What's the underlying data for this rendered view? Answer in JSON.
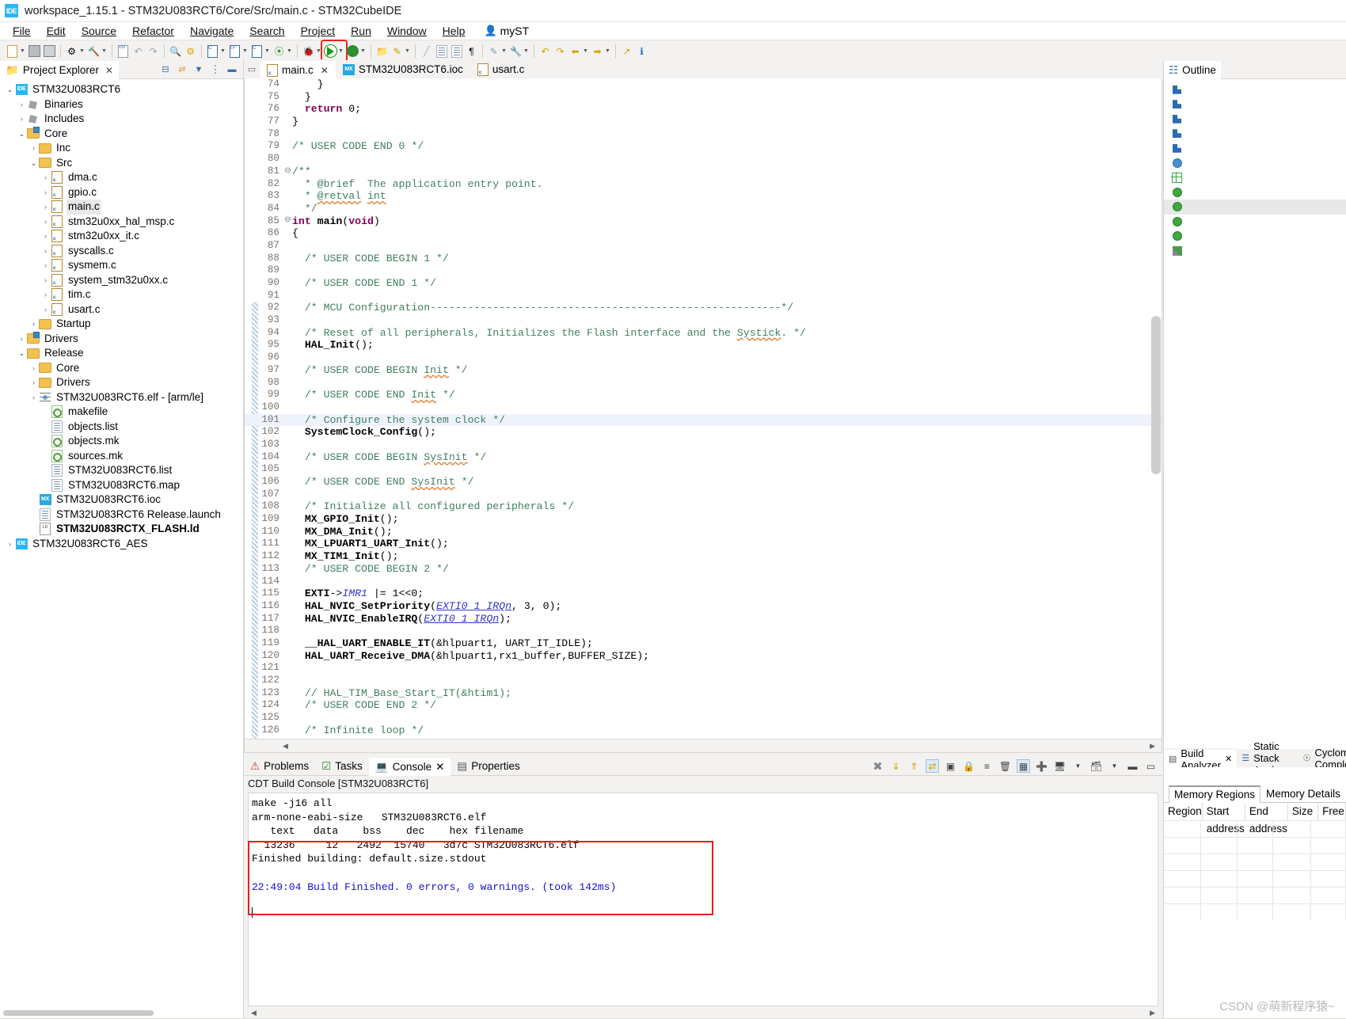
{
  "window": {
    "title": "workspace_1.15.1 - STM32U083RCT6/Core/Src/main.c - STM32CubeIDE",
    "logo": "IDE"
  },
  "menubar": {
    "items": [
      "File",
      "Edit",
      "Source",
      "Refactor",
      "Navigate",
      "Search",
      "Project",
      "Run",
      "Window",
      "Help"
    ],
    "account": "myST"
  },
  "toolbar": {
    "highlight_color": "#e8231f",
    "run_button_label": "Run",
    "groups": [
      {
        "name": "new",
        "icons": [
          "new-file-icon",
          "dropdown-arrow"
        ]
      },
      {
        "name": "save",
        "icons": [
          "save-icon",
          "save-all-icon"
        ]
      },
      {
        "name": "build",
        "icons": [
          "build-project-icon",
          "dropdown-arrow",
          "hammer-build-icon",
          "dropdown-arrow"
        ]
      },
      {
        "name": "binary",
        "icons": [
          "binary-icon"
        ]
      },
      {
        "name": "nav",
        "icons": [
          "back-undo-icon",
          "forward-redo-icon"
        ]
      },
      {
        "name": "search",
        "icons": [
          "search-icon"
        ]
      },
      {
        "name": "device",
        "icons": [
          "device-config-icon"
        ]
      },
      {
        "name": "cfg",
        "icons": [
          "c-project-icon",
          "dropdown-arrow",
          "cpp-project-icon",
          "dropdown-arrow",
          "c-file-icon",
          "dropdown-arrow"
        ]
      },
      {
        "name": "git",
        "icons": [
          "git-icon",
          "dropdown-arrow"
        ]
      },
      {
        "name": "debug",
        "icons": [
          "debug-bug-icon",
          "dropdown-arrow"
        ]
      },
      {
        "name": "run",
        "icons": [
          "run-green-icon",
          "dropdown-arrow"
        ]
      },
      {
        "name": "lock-run",
        "icons": [
          "run-lock-icon",
          "dropdown-arrow"
        ]
      },
      {
        "name": "open",
        "icons": [
          "open-resource-icon",
          "pencil-icon",
          "dropdown-arrow"
        ]
      },
      {
        "name": "format",
        "icons": [
          "ruler-icon",
          "format-doc-icon",
          "outline-icon",
          "pilcrow-icon"
        ]
      },
      {
        "name": "annotate",
        "icons": [
          "annotate-icon",
          "dropdown-arrow",
          "ext-tools-icon",
          "dropdown-arrow"
        ]
      },
      {
        "name": "history",
        "icons": [
          "prev-edit-icon",
          "next-edit-icon",
          "back-arrow-icon",
          "dropdown-arrow",
          "forward-arrow-icon",
          "dropdown-arrow"
        ]
      },
      {
        "name": "extra",
        "icons": [
          "external-link-icon",
          "info-icon"
        ]
      }
    ]
  },
  "project_explorer": {
    "title": "Project Explorer",
    "toolbar_icons": [
      "collapse-all-icon",
      "link-editor-icon",
      "filter-icon",
      "view-menu-icon",
      "minimize-icon"
    ],
    "tree": [
      {
        "label": "STM32U083RCT6",
        "indent": 0,
        "arrow": "open",
        "icon": "ide-project-icon",
        "selected": false
      },
      {
        "label": "Binaries",
        "indent": 1,
        "arrow": "closed",
        "icon": "binaries-icon"
      },
      {
        "label": "Includes",
        "indent": 1,
        "arrow": "closed",
        "icon": "includes-icon"
      },
      {
        "label": "Core",
        "indent": 1,
        "arrow": "open",
        "icon": "source-folder-icon"
      },
      {
        "label": "Inc",
        "indent": 2,
        "arrow": "closed",
        "icon": "folder-icon"
      },
      {
        "label": "Src",
        "indent": 2,
        "arrow": "open",
        "icon": "folder-icon"
      },
      {
        "label": "dma.c",
        "indent": 3,
        "arrow": "closed",
        "icon": "c-file-icon"
      },
      {
        "label": "gpio.c",
        "indent": 3,
        "arrow": "closed",
        "icon": "c-file-icon"
      },
      {
        "label": "main.c",
        "indent": 3,
        "arrow": "closed",
        "icon": "c-file-icon",
        "selected": true
      },
      {
        "label": "stm32u0xx_hal_msp.c",
        "indent": 3,
        "arrow": "closed",
        "icon": "c-file-icon"
      },
      {
        "label": "stm32u0xx_it.c",
        "indent": 3,
        "arrow": "closed",
        "icon": "c-file-icon"
      },
      {
        "label": "syscalls.c",
        "indent": 3,
        "arrow": "closed",
        "icon": "c-file-icon"
      },
      {
        "label": "sysmem.c",
        "indent": 3,
        "arrow": "closed",
        "icon": "c-file-icon"
      },
      {
        "label": "system_stm32u0xx.c",
        "indent": 3,
        "arrow": "closed",
        "icon": "c-file-icon"
      },
      {
        "label": "tim.c",
        "indent": 3,
        "arrow": "closed",
        "icon": "c-file-icon"
      },
      {
        "label": "usart.c",
        "indent": 3,
        "arrow": "closed",
        "icon": "c-file-icon"
      },
      {
        "label": "Startup",
        "indent": 2,
        "arrow": "closed",
        "icon": "folder-icon"
      },
      {
        "label": "Drivers",
        "indent": 1,
        "arrow": "closed",
        "icon": "source-folder-icon"
      },
      {
        "label": "Release",
        "indent": 1,
        "arrow": "open",
        "icon": "folder-icon"
      },
      {
        "label": "Core",
        "indent": 2,
        "arrow": "closed",
        "icon": "folder-icon"
      },
      {
        "label": "Drivers",
        "indent": 2,
        "arrow": "closed",
        "icon": "folder-icon"
      },
      {
        "label": "STM32U083RCT6.elf - [arm/le]",
        "indent": 2,
        "arrow": "closed",
        "icon": "elf-icon"
      },
      {
        "label": "makefile",
        "indent": 3,
        "arrow": "none",
        "icon": "makefile-icon"
      },
      {
        "label": "objects.list",
        "indent": 3,
        "arrow": "none",
        "icon": "plain-file-icon"
      },
      {
        "label": "objects.mk",
        "indent": 3,
        "arrow": "none",
        "icon": "makefile-icon"
      },
      {
        "label": "sources.mk",
        "indent": 3,
        "arrow": "none",
        "icon": "makefile-icon"
      },
      {
        "label": "STM32U083RCT6.list",
        "indent": 3,
        "arrow": "none",
        "icon": "plain-file-icon"
      },
      {
        "label": "STM32U083RCT6.map",
        "indent": 3,
        "arrow": "none",
        "icon": "plain-file-icon"
      },
      {
        "label": "STM32U083RCT6.ioc",
        "indent": 2,
        "arrow": "none",
        "icon": "ioc-icon"
      },
      {
        "label": "STM32U083RCT6 Release.launch",
        "indent": 2,
        "arrow": "none",
        "icon": "plain-file-icon"
      },
      {
        "label": "STM32U083RCTX_FLASH.ld",
        "indent": 2,
        "arrow": "none",
        "icon": "ld-file-icon",
        "bold": true
      },
      {
        "label": "STM32U083RCT6_AES",
        "indent": 0,
        "arrow": "closed",
        "icon": "ide-project-closed-icon"
      }
    ]
  },
  "editor": {
    "tabs": [
      {
        "label": "main.c",
        "icon": "c-file-icon",
        "active": true,
        "closable": true
      },
      {
        "label": "STM32U083RCT6.ioc",
        "icon": "ioc-icon",
        "active": false,
        "closable": false
      },
      {
        "label": "usart.c",
        "icon": "c-file-icon",
        "active": false,
        "closable": false
      }
    ],
    "first_line": 74,
    "highlighted_line": 101,
    "lines": [
      {
        "n": 74,
        "text": "    }",
        "style": "plain"
      },
      {
        "n": 75,
        "text": "  }",
        "style": "plain"
      },
      {
        "n": 76,
        "text": "  return 0;",
        "style": "return"
      },
      {
        "n": 77,
        "text": "}",
        "style": "plain"
      },
      {
        "n": 78,
        "text": "",
        "style": "plain"
      },
      {
        "n": 79,
        "text": "/* USER CODE END 0 */",
        "style": "comment"
      },
      {
        "n": 80,
        "text": "",
        "style": "plain"
      },
      {
        "n": 81,
        "text": "/**",
        "style": "comment",
        "fold": true
      },
      {
        "n": 82,
        "text": "  * @brief  The application entry point.",
        "style": "comment"
      },
      {
        "n": 83,
        "text": "  * @retval int",
        "style": "comment-wavy"
      },
      {
        "n": 84,
        "text": "  */",
        "style": "comment"
      },
      {
        "n": 85,
        "text": "int main(void)",
        "style": "main-decl",
        "fold": true
      },
      {
        "n": 86,
        "text": "{",
        "style": "plain"
      },
      {
        "n": 87,
        "text": "",
        "style": "plain"
      },
      {
        "n": 88,
        "text": "  /* USER CODE BEGIN 1 */",
        "style": "comment"
      },
      {
        "n": 89,
        "text": "",
        "style": "plain"
      },
      {
        "n": 90,
        "text": "  /* USER CODE END 1 */",
        "style": "comment"
      },
      {
        "n": 91,
        "text": "",
        "style": "plain"
      },
      {
        "n": 92,
        "text": "  /* MCU Configuration--------------------------------------------------------*/",
        "style": "comment"
      },
      {
        "n": 93,
        "text": "",
        "style": "plain"
      },
      {
        "n": 94,
        "text": "  /* Reset of all peripherals, Initializes the Flash interface and the Systick. */",
        "style": "comment-systick"
      },
      {
        "n": 95,
        "text": "  HAL_Init();",
        "style": "bold-call"
      },
      {
        "n": 96,
        "text": "",
        "style": "plain"
      },
      {
        "n": 97,
        "text": "  /* USER CODE BEGIN Init */",
        "style": "comment-init"
      },
      {
        "n": 98,
        "text": "",
        "style": "plain"
      },
      {
        "n": 99,
        "text": "  /* USER CODE END Init */",
        "style": "comment-init"
      },
      {
        "n": 100,
        "text": "",
        "style": "plain"
      },
      {
        "n": 101,
        "text": "  /* Configure the system clock */",
        "style": "comment"
      },
      {
        "n": 102,
        "text": "  SystemClock_Config();",
        "style": "bold-call"
      },
      {
        "n": 103,
        "text": "",
        "style": "plain"
      },
      {
        "n": 104,
        "text": "  /* USER CODE BEGIN SysInit */",
        "style": "comment-sysinit"
      },
      {
        "n": 105,
        "text": "",
        "style": "plain"
      },
      {
        "n": 106,
        "text": "  /* USER CODE END SysInit */",
        "style": "comment-sysinit"
      },
      {
        "n": 107,
        "text": "",
        "style": "plain"
      },
      {
        "n": 108,
        "text": "  /* Initialize all configured peripherals */",
        "style": "comment"
      },
      {
        "n": 109,
        "text": "  MX_GPIO_Init();",
        "style": "bold-call"
      },
      {
        "n": 110,
        "text": "  MX_DMA_Init();",
        "style": "bold-call"
      },
      {
        "n": 111,
        "text": "  MX_LPUART1_UART_Init();",
        "style": "bold-call"
      },
      {
        "n": 112,
        "text": "  MX_TIM1_Init();",
        "style": "bold-call"
      },
      {
        "n": 113,
        "text": "  /* USER CODE BEGIN 2 */",
        "style": "comment"
      },
      {
        "n": 114,
        "text": "",
        "style": "plain"
      },
      {
        "n": 115,
        "text": "  EXTI->IMR1 |= 1<<0;",
        "style": "exti"
      },
      {
        "n": 116,
        "text": "  HAL_NVIC_SetPriority(EXTI0_1_IRQn, 3, 0);",
        "style": "nvic1"
      },
      {
        "n": 117,
        "text": "  HAL_NVIC_EnableIRQ(EXTI0_1_IRQn);",
        "style": "nvic2"
      },
      {
        "n": 118,
        "text": "",
        "style": "plain"
      },
      {
        "n": 119,
        "text": "  __HAL_UART_ENABLE_IT(&hlpuart1, UART_IT_IDLE);",
        "style": "bold-call"
      },
      {
        "n": 120,
        "text": "  HAL_UART_Receive_DMA(&hlpuart1,rx1_buffer,BUFFER_SIZE);",
        "style": "bold-call"
      },
      {
        "n": 121,
        "text": "",
        "style": "plain"
      },
      {
        "n": 122,
        "text": "",
        "style": "plain"
      },
      {
        "n": 123,
        "text": "  // HAL_TIM_Base_Start_IT(&htim1);",
        "style": "comment"
      },
      {
        "n": 124,
        "text": "  /* USER CODE END 2 */",
        "style": "comment"
      },
      {
        "n": 125,
        "text": "",
        "style": "plain"
      },
      {
        "n": 126,
        "text": "  /* Infinite loop */",
        "style": "comment"
      }
    ]
  },
  "console": {
    "tabs": [
      {
        "label": "Problems",
        "icon": "problems-icon",
        "active": false
      },
      {
        "label": "Tasks",
        "icon": "tasks-icon",
        "active": false
      },
      {
        "label": "Console",
        "icon": "console-icon",
        "active": true,
        "closable": true
      },
      {
        "label": "Properties",
        "icon": "properties-icon",
        "active": false
      }
    ],
    "toolbar_icons": [
      "terminate-icon",
      "scroll-down-icon",
      "scroll-up-icon",
      "clear-console-icon",
      "pin-console-icon",
      "lock-scroll-icon",
      "word-wrap-icon",
      "clear-icon",
      "show-console-icon",
      "new-console-icon",
      "display-console-icon",
      "dropdown-arrow",
      "open-console-icon",
      "dropdown-arrow",
      "minimize-icon",
      "maximize-icon"
    ],
    "subtitle": "CDT Build Console [STM32U083RCT6]",
    "output_lines": [
      "make -j16 all",
      "arm-none-eabi-size   STM32U083RCT6.elf",
      "   text\t   data\t    bss\t    dec\t    hex filename",
      "  13236\t     12\t   2492\t  15740\t   3d7c STM32U083RCT6.elf",
      "Finished building: default.size.stdout",
      ""
    ],
    "build_table": {
      "headers": [
        "text",
        "data",
        "bss",
        "dec",
        "hex",
        "filename"
      ],
      "values": [
        "13236",
        "12",
        "2492",
        "15740",
        "3d7c",
        "STM32U083RCT6.elf"
      ]
    },
    "status_line": "22:49:04 Build Finished. 0 errors, 0 warnings. (took 142ms)",
    "status_color": "#1111cc",
    "highlight_color": "#ee1c1c"
  },
  "outline": {
    "title": "Outline",
    "rows": [
      {
        "icon": "include-icon",
        "kind": "sq"
      },
      {
        "icon": "include-icon",
        "kind": "sq"
      },
      {
        "icon": "include-icon",
        "kind": "sq"
      },
      {
        "icon": "include-icon",
        "kind": "sq"
      },
      {
        "icon": "include-icon",
        "kind": "sq"
      },
      {
        "icon": "type-icon",
        "kind": "ballblue"
      },
      {
        "icon": "define-icon",
        "kind": "cross"
      },
      {
        "icon": "variable-icon",
        "kind": "ballgreen"
      },
      {
        "icon": "function-icon",
        "kind": "ballgreen",
        "selected": true
      },
      {
        "icon": "function-icon",
        "kind": "ballgreen"
      },
      {
        "icon": "function-icon",
        "kind": "ballgreen"
      },
      {
        "icon": "marker-icon",
        "kind": "pencil"
      }
    ]
  },
  "build_analyzer": {
    "tabs": [
      {
        "label": "Build Analyzer",
        "icon": "build-analyzer-icon",
        "active": true,
        "closable": true
      },
      {
        "label": "Static Stack Analyzer",
        "icon": "stack-analyzer-icon",
        "active": false
      },
      {
        "label": "Cyclomatic Complexity",
        "icon": "cyclomatic-icon",
        "active": false
      }
    ],
    "subtabs": [
      {
        "label": "Memory Regions",
        "active": true
      },
      {
        "label": "Memory Details",
        "active": false
      }
    ],
    "table": {
      "headers": [
        "Region",
        "Start address",
        "End address",
        "Size",
        "Free"
      ],
      "rows": []
    }
  },
  "watermark": "CSDN @萌新程序猿~"
}
